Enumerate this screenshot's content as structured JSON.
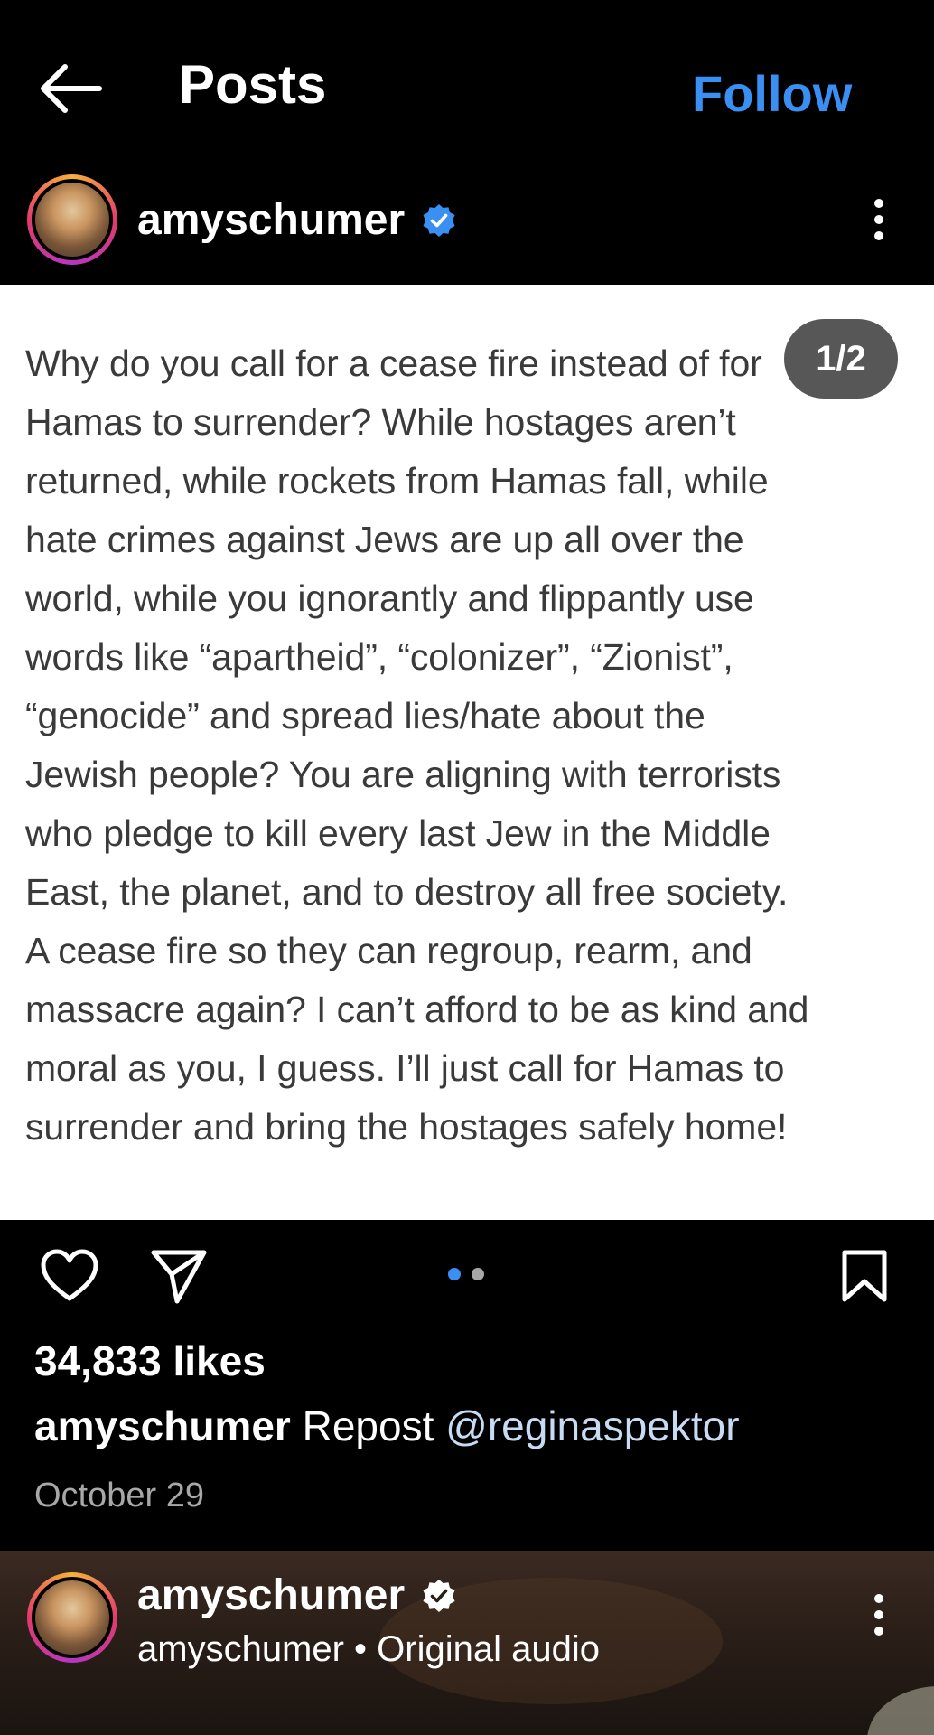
{
  "header": {
    "back_icon": "arrow-left-icon",
    "title": "Posts",
    "follow_label": "Follow",
    "follow_color": "#3a8ff2"
  },
  "post": {
    "username": "amyschumer",
    "verified_icon": "verified-badge-icon",
    "verified_color": "#3a8ff2",
    "more_icon": "more-vertical-icon",
    "carousel_position": "1/2",
    "image_text": "Why do you call for a cease fire instead of for\nHamas to surrender? While hostages aren’t\nreturned, while rockets from Hamas fall, while\nhate crimes against Jews are up all over the\nworld, while you ignorantly and flippantly use\nwords like “apartheid”, “colonizer”, “Zionist”,\n“genocide” and spread lies/hate about the\nJewish people? You are aligning with terrorists\nwho pledge to kill every last Jew in the Middle\nEast, the planet, and to destroy all free society.\nA cease fire so they can regroup, rearm, and\nmassacre again? I can’t afford to be as kind and\nmoral as you, I guess. I’ll just call for Hamas to\nsurrender and bring the hostages safely home!",
    "actions": {
      "like_icon": "heart-icon",
      "share_icon": "send-icon",
      "save_icon": "bookmark-icon"
    },
    "carousel_dots": {
      "count": 2,
      "active_index": 0,
      "active_color": "#3a8ff2",
      "inactive_color": "#a8a8a8"
    },
    "likes": "34,833 likes",
    "caption_user": "amyschumer",
    "caption_text": "Repost",
    "caption_mention": "@reginaspektor",
    "date": "October 29"
  },
  "next_post": {
    "username": "amyschumer",
    "verified_icon": "verified-badge-icon",
    "audio_line": "amyschumer • Original audio",
    "more_icon": "more-vertical-icon"
  }
}
